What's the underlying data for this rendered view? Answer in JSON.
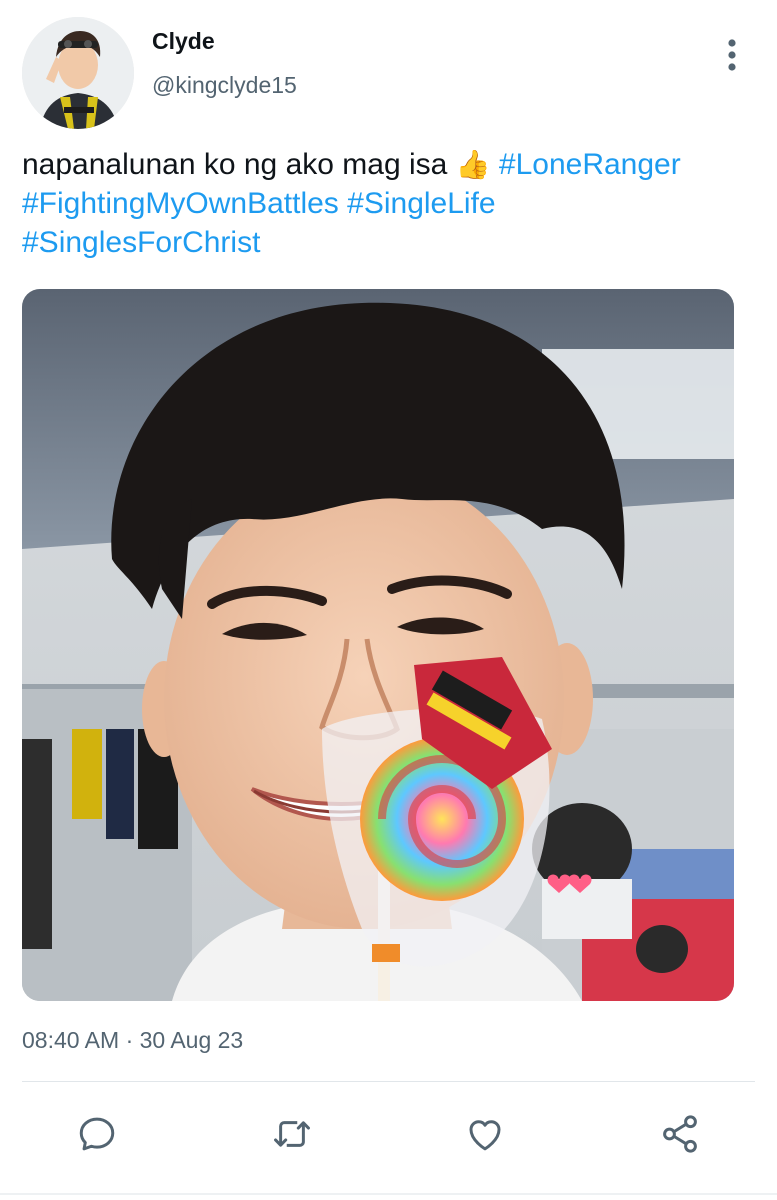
{
  "author": {
    "name": "Clyde",
    "handle": "@kingclyde15",
    "avatar_icon": "profile-photo"
  },
  "tweet": {
    "text_plain": "napanalunan ko ng ako mag isa",
    "emoji": "👍",
    "hashtags": [
      "#LoneRanger",
      "#FightingMyOwnBattles",
      "#SingleLife",
      "#SinglesForChrist"
    ],
    "hashtag_color": "#1d9bf0"
  },
  "media": {
    "type": "photo",
    "icon": "photo-of-smiling-boy-with-lollipop"
  },
  "meta": {
    "timestamp": "08:40 AM · 30 Aug 23"
  },
  "actions": [
    {
      "name": "reply",
      "icon": "comment-icon"
    },
    {
      "name": "retweet",
      "icon": "retweet-icon"
    },
    {
      "name": "like",
      "icon": "heart-icon"
    },
    {
      "name": "share",
      "icon": "share-icon"
    }
  ],
  "colors": {
    "text": "#0f1419",
    "secondary": "#536471",
    "accent": "#1d9bf0",
    "divider": "#e1e6ea"
  }
}
